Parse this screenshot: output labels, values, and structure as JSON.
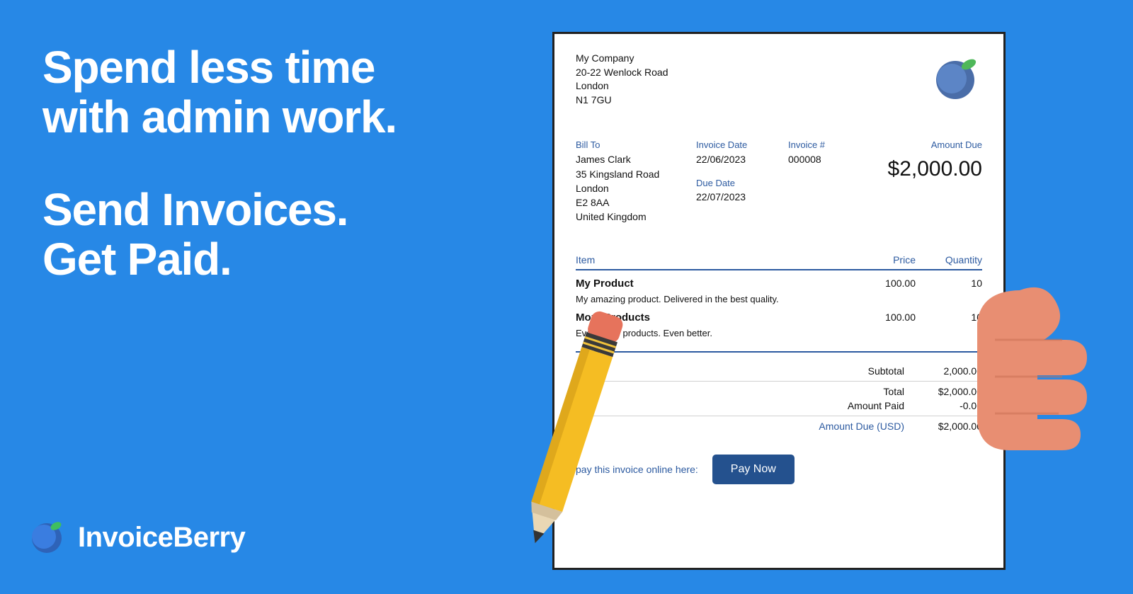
{
  "hero": {
    "line1": "Spend less time",
    "line2": "with admin work.",
    "line3": "Send Invoices.",
    "line4": "Get Paid."
  },
  "brand": {
    "name": "InvoiceBerry"
  },
  "invoice": {
    "company": {
      "name": "My Company",
      "addr1": "20-22 Wenlock Road",
      "city": "London",
      "postcode": "N1 7GU"
    },
    "labels": {
      "bill_to": "Bill To",
      "invoice_date": "Invoice Date",
      "due_date": "Due Date",
      "invoice_no": "Invoice #",
      "amount_due": "Amount Due",
      "item": "Item",
      "price": "Price",
      "quantity": "Quantity",
      "subtotal": "Subtotal",
      "total": "Total",
      "amount_paid": "Amount Paid",
      "amount_due_currency": "Amount Due (USD)"
    },
    "bill_to": {
      "name": "James Clark",
      "addr1": "35 Kingsland Road",
      "city": "London",
      "postcode": "E2 8AA",
      "country": "United Kingdom"
    },
    "invoice_date": "22/06/2023",
    "due_date": "22/07/2023",
    "invoice_no": "000008",
    "amount_due_big": "$2,000.00",
    "items": [
      {
        "name": "My Product",
        "desc": "My amazing product. Delivered in the best quality.",
        "price": "100.00",
        "qty": "10"
      },
      {
        "name": "More Products",
        "desc": "Even more products. Even better.",
        "price": "100.00",
        "qty": "10"
      }
    ],
    "totals": {
      "subtotal": "2,000.00",
      "total": "$2,000.00",
      "amount_paid": "-0.00",
      "amount_due": "$2,000.00"
    },
    "pay_text": "pay this invoice online here:",
    "pay_button": "Pay Now"
  }
}
